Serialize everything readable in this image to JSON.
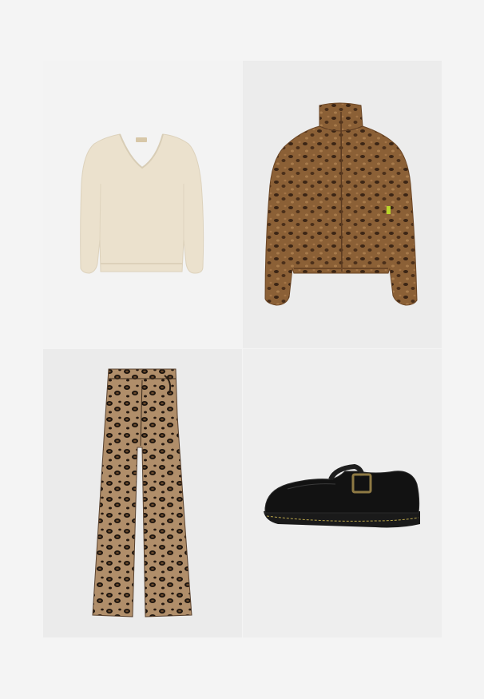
{
  "outfit": {
    "items": [
      {
        "name": "sweater",
        "color": "#ece2cf",
        "icon": "v-neck-knit-sweater"
      },
      {
        "name": "jacket",
        "color": "#8a5e36",
        "icon": "leopard-fleece-jacket"
      },
      {
        "name": "pants",
        "color": "#8a6a4c",
        "icon": "leopard-wide-leg-pants"
      },
      {
        "name": "shoe",
        "color": "#141414",
        "icon": "black-mary-jane-shoe"
      }
    ],
    "label_text": "----"
  }
}
